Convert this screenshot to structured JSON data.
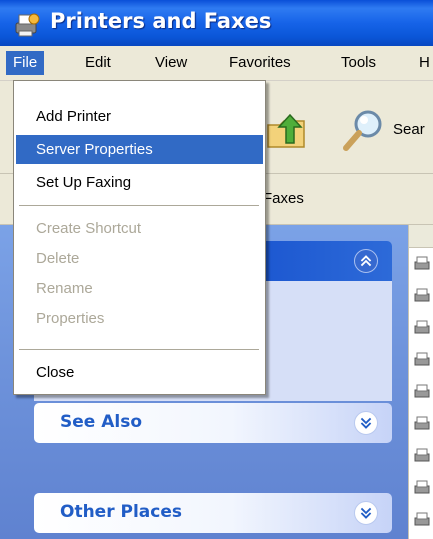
{
  "window": {
    "title": "Printers and Faxes",
    "icon": "printer-fax-icon"
  },
  "menubar": {
    "items": [
      {
        "label": "File",
        "active": true
      },
      {
        "label": "Edit"
      },
      {
        "label": "View"
      },
      {
        "label": "Favorites"
      },
      {
        "label": "Tools"
      },
      {
        "label": "H"
      }
    ]
  },
  "toolbar": {
    "up_icon": "folder-up-icon",
    "search_icon": "search-icon",
    "search_label": "Sear"
  },
  "addressbar": {
    "text": "Faxes"
  },
  "file_menu": {
    "items": [
      {
        "label": "Add Printer",
        "state": "enabled"
      },
      {
        "label": "Server Properties",
        "state": "highlighted"
      },
      {
        "label": "Set Up Faxing",
        "state": "enabled"
      },
      {
        "label": "Create Shortcut",
        "state": "disabled"
      },
      {
        "label": "Delete",
        "state": "disabled"
      },
      {
        "label": "Rename",
        "state": "disabled"
      },
      {
        "label": "Properties",
        "state": "disabled"
      },
      {
        "label": "Close",
        "state": "enabled"
      }
    ]
  },
  "taskpane": {
    "panels": [
      {
        "title": "",
        "chevron": "collapse-chevron-icon"
      },
      {
        "title": "See Also",
        "chevron": "expand-chevron-icon"
      },
      {
        "title": "Other Places",
        "chevron": "expand-chevron-icon"
      }
    ]
  },
  "colors": {
    "titlebar": "#0a56d8",
    "menu_highlight": "#316ac5",
    "taskpane": "#6f94dc",
    "panel_title": "#215dc6",
    "disabled_text": "#aca899"
  }
}
